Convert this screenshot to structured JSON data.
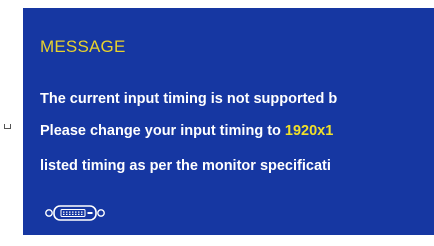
{
  "message_box": {
    "title": "MESSAGE",
    "line1": "The current input timing is not supported b",
    "line2_prefix": "Please change your input timing to ",
    "line2_highlight": "1920x1",
    "line3": "listed timing as per the monitor specificati",
    "icon": "dvi-connector-icon"
  },
  "colors": {
    "panel_background": "#1637a2",
    "title_text": "#e8d22c",
    "body_text": "#ffffff",
    "highlight_text": "#f0e02a"
  }
}
